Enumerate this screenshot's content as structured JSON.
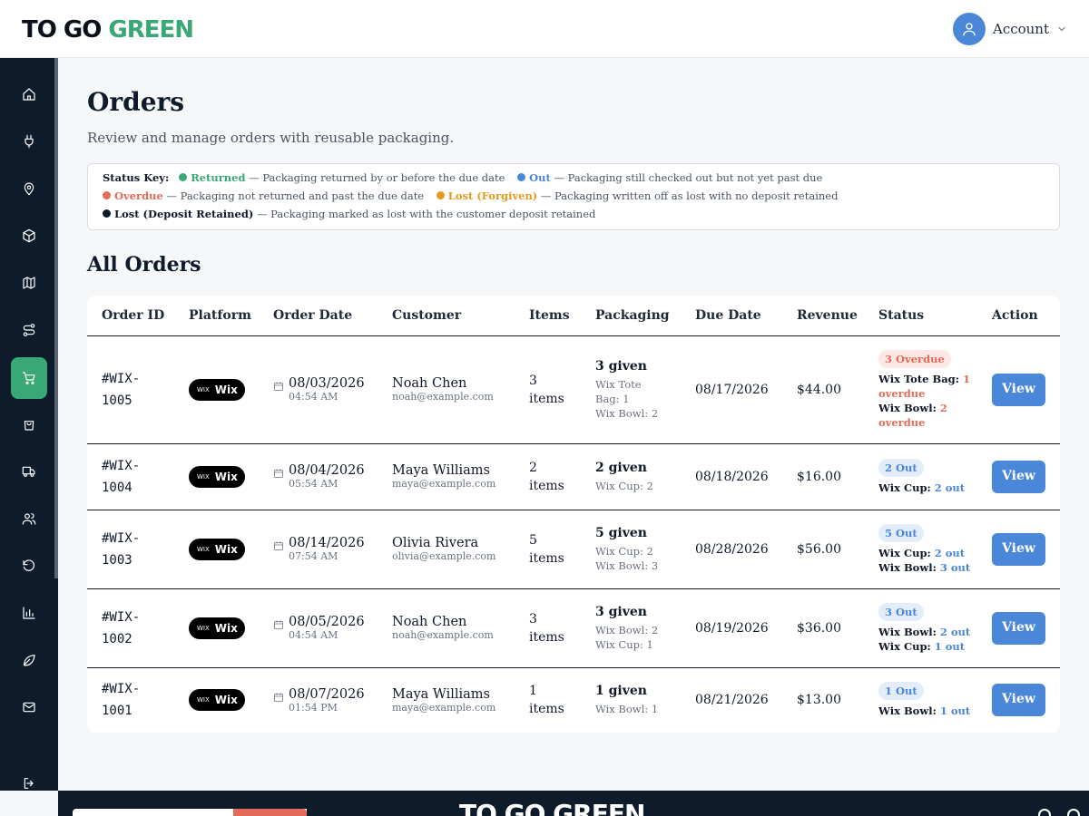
{
  "brand": {
    "logo_dark": "TO GO ",
    "logo_green": "GREEN",
    "footer_logo": "TO GO GREEN"
  },
  "header": {
    "account_label": "Account"
  },
  "sidebar": {
    "items": [
      {
        "icon": "home-icon"
      },
      {
        "icon": "plug-icon"
      },
      {
        "icon": "map-pin-icon"
      },
      {
        "icon": "box-icon"
      },
      {
        "icon": "map-icon"
      },
      {
        "icon": "route-icon"
      },
      {
        "icon": "cart-icon",
        "active": true
      },
      {
        "icon": "shopping-bag-icon"
      },
      {
        "icon": "truck-icon"
      },
      {
        "icon": "users-icon"
      },
      {
        "icon": "rotate-ccw-icon"
      },
      {
        "icon": "bar-chart-icon"
      },
      {
        "icon": "leaf-icon"
      },
      {
        "icon": "mail-icon"
      },
      {
        "icon": "logout-icon"
      }
    ]
  },
  "page": {
    "title": "Orders",
    "subtitle": "Review and manage orders with reusable packaging."
  },
  "status_key": {
    "label": "Status Key:",
    "items": [
      {
        "name": "Returned",
        "desc": " — Packaging returned by or before the due date",
        "color": "#3aa776"
      },
      {
        "name": "Out",
        "desc": " — Packaging still checked out but not yet past due",
        "color": "#4a87d8"
      },
      {
        "name": "Overdue",
        "desc": " — Packaging not returned and past the due date",
        "color": "#e46b5a"
      },
      {
        "name": "Lost (Forgiven)",
        "desc": " — Packaging written off as lost with no deposit retained",
        "color": "#e39a1d"
      },
      {
        "name": "Lost (Deposit Retained)",
        "desc": " — Packaging marked as lost with the customer deposit retained",
        "color": "#0d1b2a"
      }
    ]
  },
  "orders_section": {
    "title": "All Orders",
    "columns": [
      "Order ID",
      "Platform",
      "Order Date",
      "Customer",
      "Items",
      "Packaging",
      "Due Date",
      "Revenue",
      "Status",
      "Action"
    ],
    "rows": [
      {
        "order_id_1": "#WIX-",
        "order_id_2": "1005",
        "platform_small": "WIX",
        "platform": "Wix",
        "date": "08/03/2026",
        "time": "04:54 AM",
        "customer": "Noah Chen",
        "email": "noah@example.com",
        "items_1": "3",
        "items_2": "items",
        "pack_given": "3 given",
        "pack_lines": [
          "Wix Tote",
          "Bag: 1",
          "Wix Bowl: 2"
        ],
        "due": "08/17/2026",
        "revenue": "$44.00",
        "badge": "3 Overdue",
        "badge_type": "overdue",
        "status_lines": [
          {
            "label": "Wix Tote Bag: ",
            "value": "1",
            "cont": "overdue"
          },
          {
            "label": "Wix Bowl: ",
            "value": "2",
            "cont": "overdue"
          }
        ],
        "action": "View"
      },
      {
        "order_id_1": "#WIX-",
        "order_id_2": "1004",
        "platform_small": "WIX",
        "platform": "Wix",
        "date": "08/04/2026",
        "time": "05:54 AM",
        "customer": "Maya Williams",
        "email": "maya@example.com",
        "items_1": "2",
        "items_2": "items",
        "pack_given": "2 given",
        "pack_lines": [
          "Wix Cup: 2"
        ],
        "due": "08/18/2026",
        "revenue": "$16.00",
        "badge": "2 Out",
        "badge_type": "out",
        "status_lines": [
          {
            "label": "Wix Cup: ",
            "value": "2 out"
          }
        ],
        "action": "View"
      },
      {
        "order_id_1": "#WIX-",
        "order_id_2": "1003",
        "platform_small": "WIX",
        "platform": "Wix",
        "date": "08/14/2026",
        "time": "07:54 AM",
        "customer": "Olivia Rivera",
        "email": "olivia@example.com",
        "items_1": "5",
        "items_2": "items",
        "pack_given": "5 given",
        "pack_lines": [
          "Wix Cup: 2",
          "Wix Bowl: 3"
        ],
        "due": "08/28/2026",
        "revenue": "$56.00",
        "badge": "5 Out",
        "badge_type": "out",
        "status_lines": [
          {
            "label": "Wix Cup: ",
            "value": "2 out"
          },
          {
            "label": "Wix Bowl: ",
            "value": "3 out"
          }
        ],
        "action": "View"
      },
      {
        "order_id_1": "#WIX-",
        "order_id_2": "1002",
        "platform_small": "WIX",
        "platform": "Wix",
        "date": "08/05/2026",
        "time": "04:54 AM",
        "customer": "Noah Chen",
        "email": "noah@example.com",
        "items_1": "3",
        "items_2": "items",
        "pack_given": "3 given",
        "pack_lines": [
          "Wix Bowl: 2",
          "Wix Cup: 1"
        ],
        "due": "08/19/2026",
        "revenue": "$36.00",
        "badge": "3 Out",
        "badge_type": "out",
        "status_lines": [
          {
            "label": "Wix Bowl: ",
            "value": "2 out"
          },
          {
            "label": "Wix Cup: ",
            "value": "1 out"
          }
        ],
        "action": "View"
      },
      {
        "order_id_1": "#WIX-",
        "order_id_2": "1001",
        "platform_small": "WIX",
        "platform": "Wix",
        "date": "08/07/2026",
        "time": "01:54 PM",
        "customer": "Maya Williams",
        "email": "maya@example.com",
        "items_1": "1",
        "items_2": "items",
        "pack_given": "1 given",
        "pack_lines": [
          "Wix Bowl: 1"
        ],
        "due": "08/21/2026",
        "revenue": "$13.00",
        "badge": "1 Out",
        "badge_type": "out",
        "status_lines": [
          {
            "label": "Wix Bowl: ",
            "value": "1 out"
          }
        ],
        "action": "View"
      }
    ]
  },
  "colors": {
    "sidebar_bg": "#0d1b2a",
    "brand_green": "#3aa776",
    "primary_blue": "#4a87d8",
    "overdue_red": "#e46b5a",
    "forgiven_amber": "#e39a1d"
  }
}
